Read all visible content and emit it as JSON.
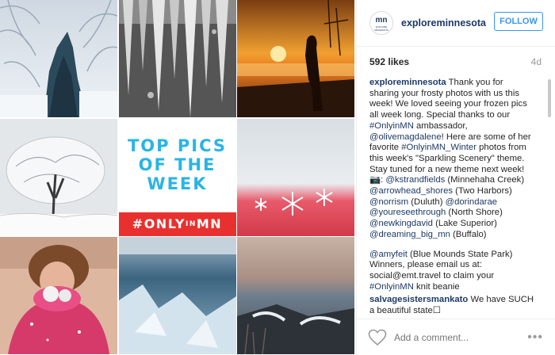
{
  "post": {
    "center_tile": {
      "headline_lines": [
        "TOP PICS",
        "OF THE",
        "WEEK"
      ],
      "banner": "#ONLY",
      "banner_small": "IN",
      "banner_end": "MN"
    }
  },
  "header": {
    "avatar_text": "mn",
    "avatar_subtext": "EXPLORE MINNESOTA",
    "username": "exploreminnesota",
    "follow_label": "FOLLOW"
  },
  "meta": {
    "likes": "592 likes",
    "age": "4d"
  },
  "caption": {
    "username": "exploreminnesota",
    "p1": " Thank you for sharing your frosty photos with us this week! We loved seeing your frozen pics all week long. Special thanks to our ",
    "tag_onlyinmn": "#OnlyinMN",
    "p2": " ambassador, ",
    "mention_olive": "@olivemagdalene",
    "p3": "! Here are some of her favorite ",
    "tag_winter": "#OnlyinMN_Winter",
    "p4": " photos from this week's \"Sparkling Scenery\" theme. Stay tuned for a new theme next week! ",
    "camera_emoji": "📷",
    "p5": ": ",
    "credits": [
      {
        "handle": "@kstrandfields",
        "place": " (Minnehaha Creek)"
      },
      {
        "handle": "@arrowhead_shores",
        "place": " (Two Harbors)"
      },
      {
        "handle": "@norrism",
        "place": " (Duluth) ",
        "handle2": "@dorindarae"
      },
      {
        "handle": "@youreseethrough",
        "place": " (North Shore)"
      },
      {
        "handle": "@newkingdavid",
        "place": " (Lake Superior)"
      },
      {
        "handle": "@dreaming_big_mn",
        "place": " (Buffalo)"
      }
    ]
  },
  "comments": [
    {
      "mention": "@amyfeit",
      "text1": " (Blue Mounds State Park) Winners, please email us at: social@emt.travel to claim your ",
      "tag": "#OnlyinMN",
      "text2": " knit beanie"
    },
    {
      "username": "salvagesistersmankato",
      "text": " We have SUCH a beautiful state☐"
    }
  ],
  "footer": {
    "placeholder": "Add a comment...",
    "more": "•••",
    "like_icon": "heart-outline-icon"
  },
  "colors": {
    "brand_blue": "#29b4e6",
    "banner_red": "#e8312f",
    "link_navy": "#1d3a66",
    "follow_blue": "#3897f0"
  }
}
